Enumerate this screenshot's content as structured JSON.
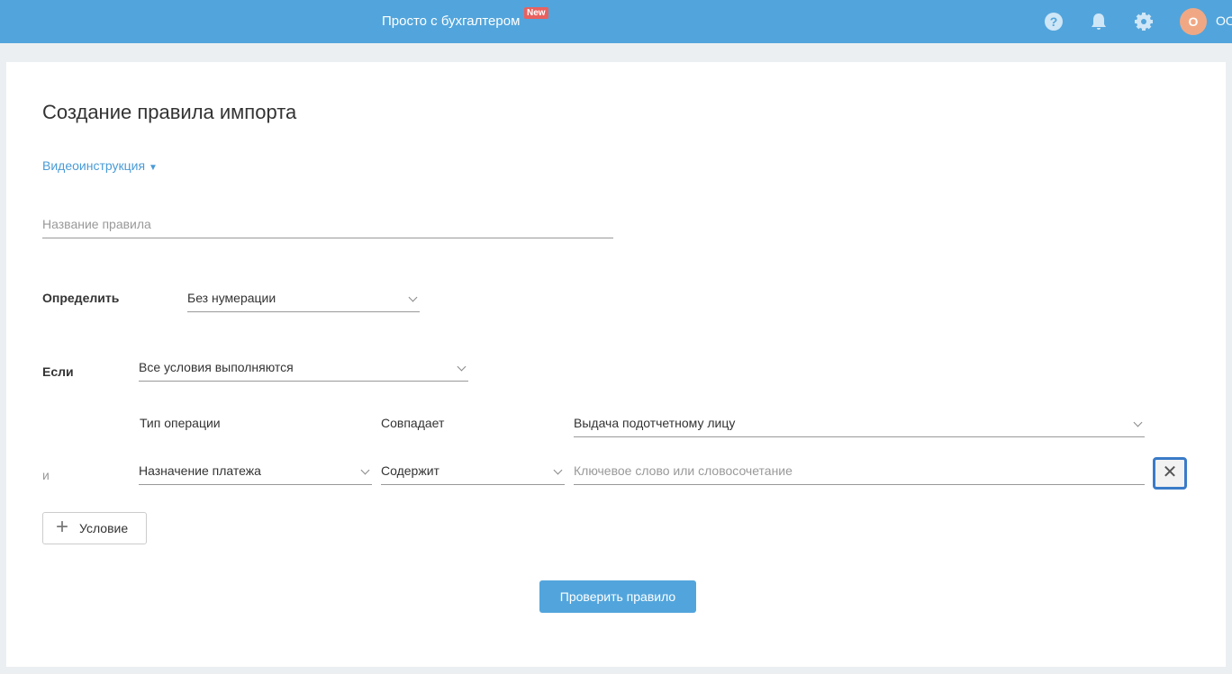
{
  "header": {
    "brand": "Просто с бухгалтером",
    "badge": "New",
    "avatar_letter": "О",
    "org": "ОО"
  },
  "page": {
    "title": "Создание правила импорта",
    "video_link": "Видеоинструкция",
    "rule_name_placeholder": "Название правила"
  },
  "define": {
    "label": "Определить",
    "value": "Без нумерации"
  },
  "if": {
    "label": "Если",
    "value": "Все условия выполняются"
  },
  "conditions": [
    {
      "prefix": "",
      "field": "Тип операции",
      "operator": "Совпадает",
      "value": "Выдача подотчетному лицу"
    },
    {
      "prefix": "и",
      "field": "Назначение платежа",
      "operator": "Содержит",
      "value_placeholder": "Ключевое слово или словосочетание"
    }
  ],
  "add_condition_label": "Условие",
  "check_button": "Проверить правило",
  "remove_label": "✕"
}
